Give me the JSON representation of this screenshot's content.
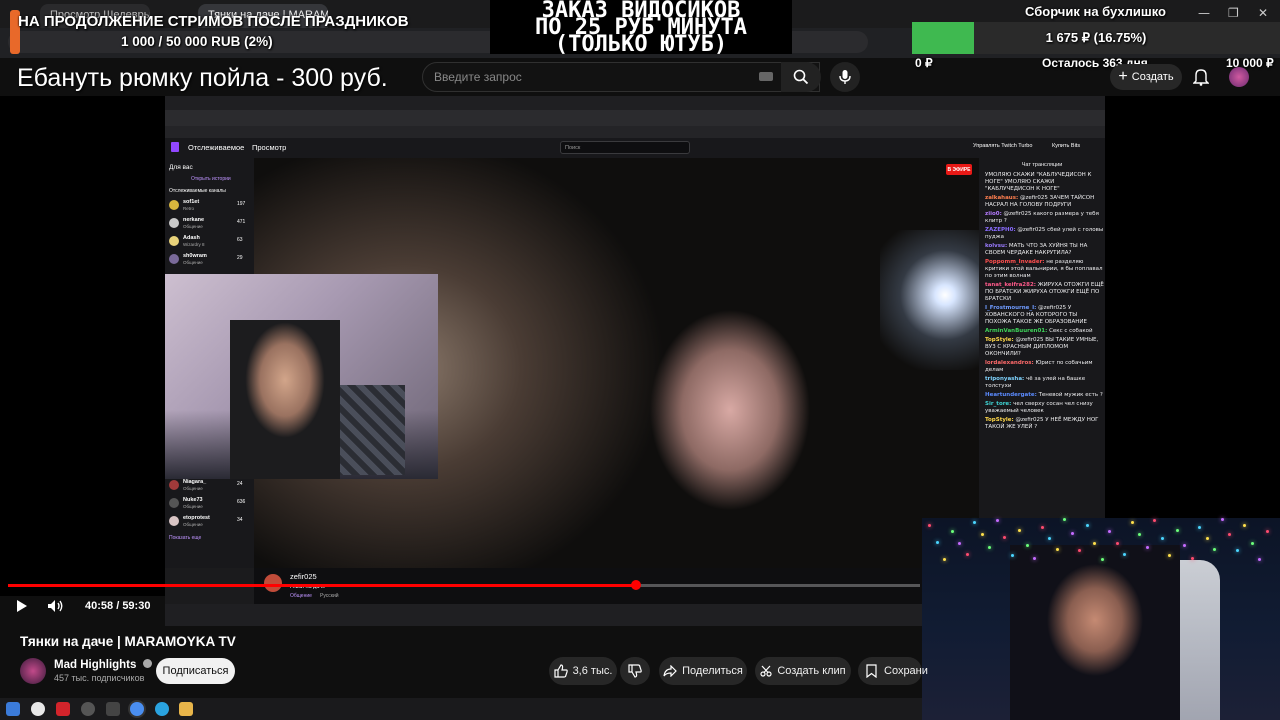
{
  "browser": {
    "tabs": [
      {
        "label": "Просмотр Шедевры у Генвест"
      },
      {
        "label": "Тянки на даче | MARAMO"
      }
    ],
    "window_controls": {
      "minimize": "—",
      "maximize": "❐",
      "close": "✕"
    }
  },
  "overlay": {
    "stream_goal_title": "НА ПРОДОЛЖЕНИЕ СТРИМОВ ПОСЛЕ ПРАЗДНИКОВ",
    "stream_goal_progress": "1 000 / 50 000 RUB (2%)",
    "promo_lines": [
      "ЗАКАЗ ВИДОСИКОВ",
      "ПО 25 РУБ МИНУТА",
      "(ТОЛЬКО ЮТУБ)"
    ],
    "donation_text": "Ебануть рюмку пойла - 300 руб.",
    "collector_title": "Сборчик на бухлишко",
    "collector_progress_label": "1 675 ₽ (16.75%)",
    "collector_progress_fraction": 0.1675,
    "collector_min": "0 ₽",
    "collector_remaining": "Осталось 363 дня",
    "collector_max": "10 000 ₽"
  },
  "youtube": {
    "search_placeholder": "Введите запрос",
    "create_label": "Создать",
    "video_title": "Тянки на даче | MARAMOYKA TV",
    "channel_name": "Mad Highlights",
    "subscribers": "457 тыс. подписчиков",
    "subscribe_label": "Подписаться",
    "likes": "3,6 тыс.",
    "share_label": "Поделиться",
    "clip_label": "Создать клип",
    "save_label": "Сохрани",
    "time_current": "40:58",
    "time_total": "59:30",
    "progress_fraction": 0.689
  },
  "twitch": {
    "nav_following": "Отслеживаемое",
    "nav_browse": "Просмотр",
    "search_placeholder": "Поиск",
    "turbo_label": "Управлять Twitch Turbo",
    "bits_label": "Купить Bits",
    "chat_title": "Чат трансляции",
    "live_badge": "В ЭФИРЕ",
    "sidebar_header": "Для вас",
    "sidebar_history": "Открыть истории",
    "sidebar_followed": "Отслеживаемые каналы",
    "sidebar_show_more": "Показать еще",
    "channels": [
      {
        "name": "sof1et",
        "game": "Retro",
        "viewers": "197"
      },
      {
        "name": "nerkane",
        "game": "Общение",
        "viewers": "471"
      },
      {
        "name": "Adash",
        "game": "Wizardry 8",
        "viewers": "63"
      },
      {
        "name": "sh0wram",
        "game": "Общение",
        "viewers": "29"
      },
      {
        "name": "Niagara_",
        "game": "Общение",
        "viewers": "24"
      },
      {
        "name": "Nuke73",
        "game": "Общение",
        "viewers": "636"
      },
      {
        "name": "etoprotest",
        "game": "Общение",
        "viewers": "34"
      }
    ],
    "streamer": "zefir025",
    "stream_title": "Гявки на даче",
    "stream_category": "Общение",
    "stream_lang": "Русский",
    "chat_messages": [
      {
        "user": "",
        "text": "УМОЛЯЮ СКАЖИ \"КАБЛУЧЕДИСОН К НОГЕ\" УМОЛЯЮ СКАЖИ \"КАБЛУЧЕДИСОН К НОГЕ\""
      },
      {
        "user": "zalkahaus:",
        "text": "@zefir025 ЗАЧЕМ ТАЙСОН НАСРАЛ НА ГОЛОВУ ПОДРУГИ"
      },
      {
        "user": "ziio0:",
        "text": "@zefir025 какого размера у тебя клитр ?"
      },
      {
        "user": "ZAZEPH0:",
        "text": "@zefir025 сбей улей с головы пуджа"
      },
      {
        "user": "kolvsu:",
        "text": "МАТЬ ЧТО ЗА ХУЙНЯ ТЫ НА СВОЕМ ЧЕРДАКЕ НАКРУТИЛА?"
      },
      {
        "user": "Poppomm_Invader:",
        "text": "не разделяю критики этой вальнирии, я бы поплавал по этим волнам"
      },
      {
        "user": "tanat_keifra282:",
        "text": "ЖИРУХА ОТОЖГИ ЕЩЁ ПО БРАТСКИ ЖИРУХА ОТОЖГИ ЕЩЁ ПО БРАТСКИ"
      },
      {
        "user": "I_Frostmourne_I:",
        "text": "@zefir025 У ХОВАНСКОГО НА КОТОРОГО ТЫ ПОХОЖА ТАКОЕ ЖЕ ОБРАЗОВАНИЕ"
      },
      {
        "user": "ArminVanBuuren01:",
        "text": "Секс с собакой"
      },
      {
        "user": "TopStyle:",
        "text": "@zefir025 ВЫ ТАКИЕ УМНЫЕ, ВУЗ С КРАСНЫМ ДИПЛОМОМ ОКОНЧИЛИ?"
      },
      {
        "user": "lordalexandros:",
        "text": "Юрист по собачьим делам"
      },
      {
        "user": "triponyasha:",
        "text": "чё за улей на башке толстухи"
      },
      {
        "user": "Heartundergate:",
        "text": "Теневой мужик есть ?"
      },
      {
        "user": "Sir_tore:",
        "text": "чел сверху сосан чел снизу уважаемый человек"
      },
      {
        "user": "TopStyle:",
        "text": "@zefir025 У НЕЁ МЕЖДУ НОГ ТАКОЙ ЖЕ УЛЕЙ ?"
      }
    ]
  }
}
